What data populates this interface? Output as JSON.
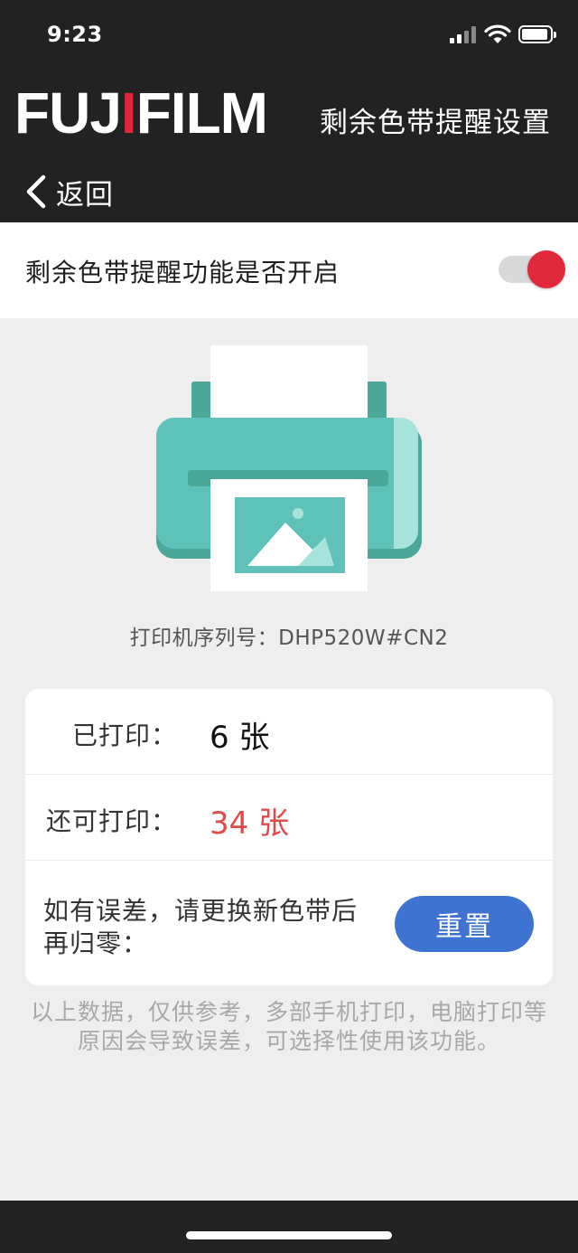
{
  "status_bar": {
    "time": "9:23",
    "signal_icon": "cellular-signal-icon",
    "wifi_icon": "wifi-icon",
    "battery_icon": "battery-icon"
  },
  "header": {
    "brand_part1": "FUJ",
    "brand_part2": "I",
    "brand_part3": "FILM",
    "title": "剩余色带提醒设置",
    "back_label": "返回",
    "back_icon": "chevron-left-icon",
    "background_color": "#222222"
  },
  "toggle": {
    "label": "剩余色带提醒功能是否开启",
    "enabled": true,
    "knob_color": "#e0293b"
  },
  "printer": {
    "icon": "printer-illustration-icon",
    "serial_label": "打印机序列号：",
    "serial_number": "DHP520W#CN2"
  },
  "counts": {
    "printed_label": "已打印：",
    "printed_value": "6 张",
    "remaining_label": "还可打印：",
    "remaining_value": "34 张",
    "remaining_color": "#df4a4a"
  },
  "reset": {
    "text": "如有误差，请更换新色带后再归零：",
    "button_label": "重置",
    "button_color": "#3f73d2"
  },
  "disclaimer": "以上数据，仅供参考，多部手机打印，电脑打印等原因会导致误差，可选择性使用该功能。"
}
